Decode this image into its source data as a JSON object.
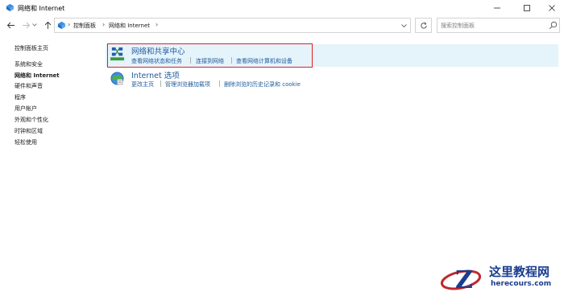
{
  "window": {
    "title": "网络和 Internet",
    "icon": "control-panel-icon"
  },
  "nav": {
    "breadcrumb": [
      "控制面板",
      "网络和 Internet"
    ],
    "search_placeholder": "搜索控制面板"
  },
  "sidebar": {
    "items": [
      {
        "label": "控制面板主页",
        "active": false
      },
      {
        "label": "系统和安全",
        "active": false
      },
      {
        "label": "网络和 Internet",
        "active": true
      },
      {
        "label": "硬件和声音",
        "active": false
      },
      {
        "label": "程序",
        "active": false
      },
      {
        "label": "用户帐户",
        "active": false
      },
      {
        "label": "外观和个性化",
        "active": false
      },
      {
        "label": "时钟和区域",
        "active": false
      },
      {
        "label": "轻松使用",
        "active": false
      }
    ]
  },
  "categories": [
    {
      "title": "网络和共享中心",
      "icon": "network-sharing-icon",
      "links": [
        "查看网络状态和任务",
        "连接到网络",
        "查看网络计算机和设备"
      ]
    },
    {
      "title": "Internet 选项",
      "icon": "internet-options-globe-icon",
      "links": [
        "更改主页",
        "管理浏览器加载项",
        "删除浏览的历史记录和 cookie"
      ]
    }
  ],
  "watermark": {
    "title": "这里教程网",
    "url": "herecours.com"
  },
  "colors": {
    "link": "#1e5a9c",
    "highlight": "#e5f3fb",
    "annotation_box": "#e02020"
  }
}
